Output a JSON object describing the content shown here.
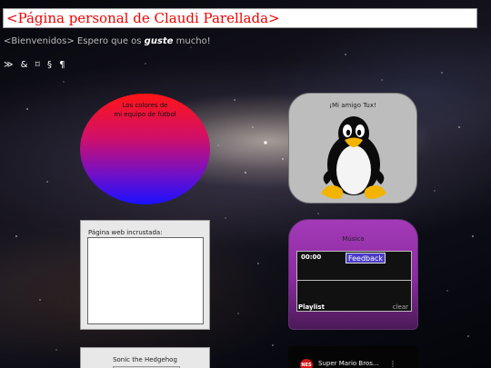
{
  "header": {
    "title": "<Página personal de Claudi Parellada>"
  },
  "welcome": {
    "before": "<Bienvenidos> Espero que os ",
    "bold": "guste",
    "after": " mucho!"
  },
  "icon_row": [
    {
      "name": "forward-icon",
      "glyph": "≫"
    },
    {
      "name": "ampersand-icon",
      "glyph": "&"
    },
    {
      "name": "frame-icon",
      "glyph": "⌑"
    },
    {
      "name": "section-icon",
      "glyph": "§"
    },
    {
      "name": "pilcrow-icon",
      "glyph": "¶"
    }
  ],
  "colors_card": {
    "line1": "Los colores de",
    "line2": "mi equipo de fútbol",
    "gradient_top": "#ff1515",
    "gradient_bottom": "#1b10ff"
  },
  "tux_card": {
    "caption": "¡Mi amigo Tux!"
  },
  "iframe_card": {
    "caption": "Página web incrustada:"
  },
  "music_card": {
    "caption": "Música",
    "time": "00:00",
    "feedback_label": "Feedback",
    "playlist_label": "Playlist",
    "clear_label": "clear"
  },
  "sonic_card": {
    "caption": "Sonic the Hedgehog"
  },
  "video_card": {
    "channel_badge": "NES",
    "title": "Super Mario Bros..."
  },
  "colors": {
    "title_red": "#ee0000",
    "music_purple": "#a43ab8",
    "feedback_blue": "#4b3cc8",
    "tux_card_gray": "#bdbdbd"
  }
}
